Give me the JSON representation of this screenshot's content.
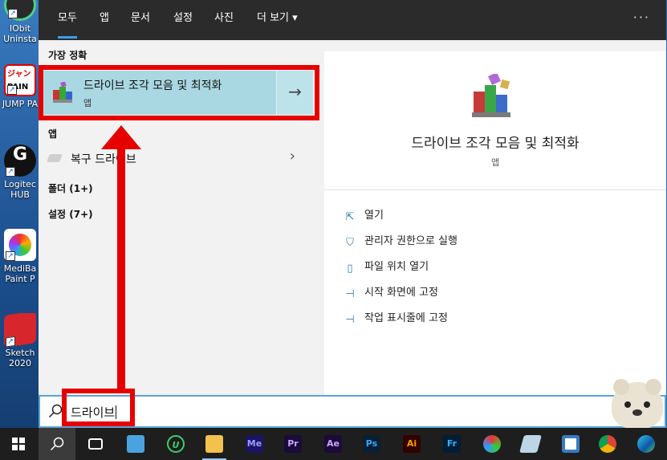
{
  "desktop": {
    "icons": [
      {
        "label": "IObit\nUninsta",
        "name": "iobit-uninstaller"
      },
      {
        "label": "JUMP PA",
        "name": "jump-paint"
      },
      {
        "label": "Logitec\nHUB",
        "name": "logitech-hub"
      },
      {
        "label": "MediBa\nPaint P",
        "name": "medibang-paint"
      },
      {
        "label": "Sketch\n2020",
        "name": "sketchup-2020"
      }
    ]
  },
  "tabs": {
    "all": "모두",
    "apps": "앱",
    "documents": "문서",
    "settings": "설정",
    "photos": "사진",
    "more": "더 보기 ▾",
    "overflow": "···"
  },
  "left": {
    "best_match_header": "가장 정확",
    "best_match": {
      "title": "드라이브 조각 모음 및 최적화",
      "subtitle": "앱",
      "arrow": "→"
    },
    "apps_header": "앱",
    "apps": [
      {
        "label": "복구 드라이브",
        "chevron": "›"
      }
    ],
    "folders": "폴더 (1+)",
    "settings": "설정 (7+)"
  },
  "detail": {
    "title": "드라이브 조각 모음 및 최적화",
    "subtitle": "앱",
    "actions": [
      {
        "label": "열기",
        "icon": "open-icon"
      },
      {
        "label": "관리자 권한으로 실행",
        "icon": "shield-icon"
      },
      {
        "label": "파일 위치 열기",
        "icon": "file-location-icon"
      },
      {
        "label": "시작 화면에 고정",
        "icon": "pin-icon"
      },
      {
        "label": "작업 표시줄에 고정",
        "icon": "pin-icon"
      }
    ]
  },
  "search": {
    "value": "드라이브"
  },
  "taskbar": {
    "items": [
      {
        "name": "windows-start-button",
        "text": ""
      },
      {
        "name": "search-button",
        "text": ""
      },
      {
        "name": "task-view-button",
        "text": ""
      },
      {
        "name": "file-explorer-app",
        "text": ""
      },
      {
        "name": "upwork-app",
        "text": "U"
      },
      {
        "name": "folder-app",
        "text": ""
      },
      {
        "name": "media-encoder-app",
        "text": "Me"
      },
      {
        "name": "premiere-pro-app",
        "text": "Pr"
      },
      {
        "name": "after-effects-app",
        "text": "Ae"
      },
      {
        "name": "photoshop-app",
        "text": "Ps"
      },
      {
        "name": "illustrator-app",
        "text": "Ai"
      },
      {
        "name": "fresco-app",
        "text": "Fr"
      },
      {
        "name": "davinci-app",
        "text": ""
      },
      {
        "name": "notes-app",
        "text": ""
      },
      {
        "name": "remote-app",
        "text": ""
      },
      {
        "name": "chrome-app",
        "text": ""
      },
      {
        "name": "edge-app",
        "text": ""
      }
    ]
  },
  "colors": {
    "highlight": "#a9d8e2",
    "annotation": "#e60000",
    "accent": "#3a9eea"
  }
}
